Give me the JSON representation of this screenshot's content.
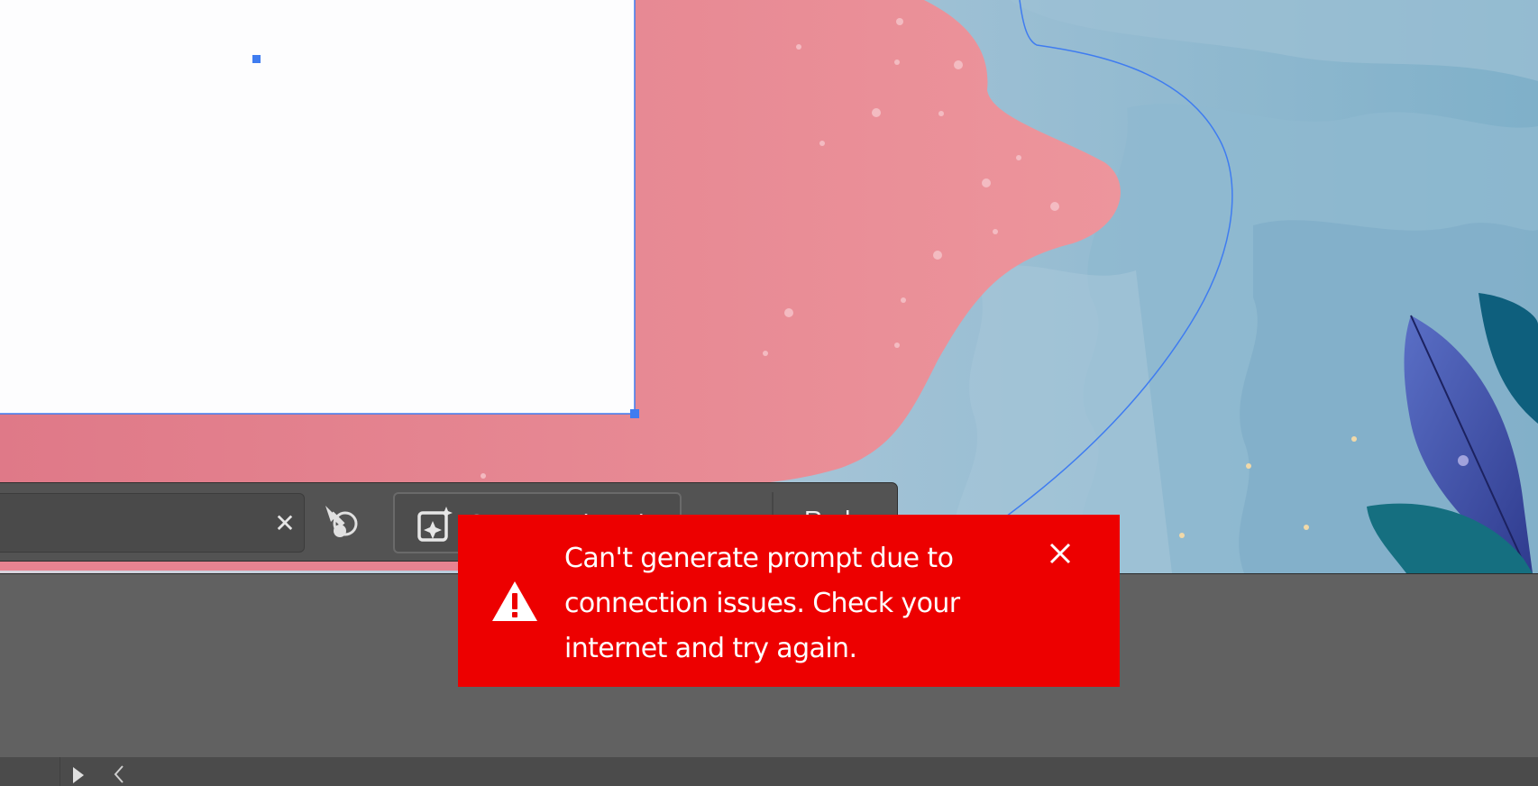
{
  "prompt_bar": {
    "input_value": "",
    "clear_icon": "close-icon",
    "eyedropper_icon": "eyedropper-icon",
    "generate_label": "Generate (Beta)",
    "generate_icon": "generative-ai-icon",
    "redo_label": "Redo"
  },
  "toast": {
    "message": "Can't generate prompt due to connection issues. Check your internet and try again.",
    "icon": "alert-icon",
    "close_icon": "close-icon",
    "background": "#ED0000"
  },
  "status_bar": {
    "play_icon": "play-icon",
    "collapse_icon": "chevron-left-icon"
  },
  "colors": {
    "canvas_background": "#616161",
    "selection": "#3f7cf0",
    "pink": "#e8858f",
    "blue": "#8ab6cd"
  }
}
